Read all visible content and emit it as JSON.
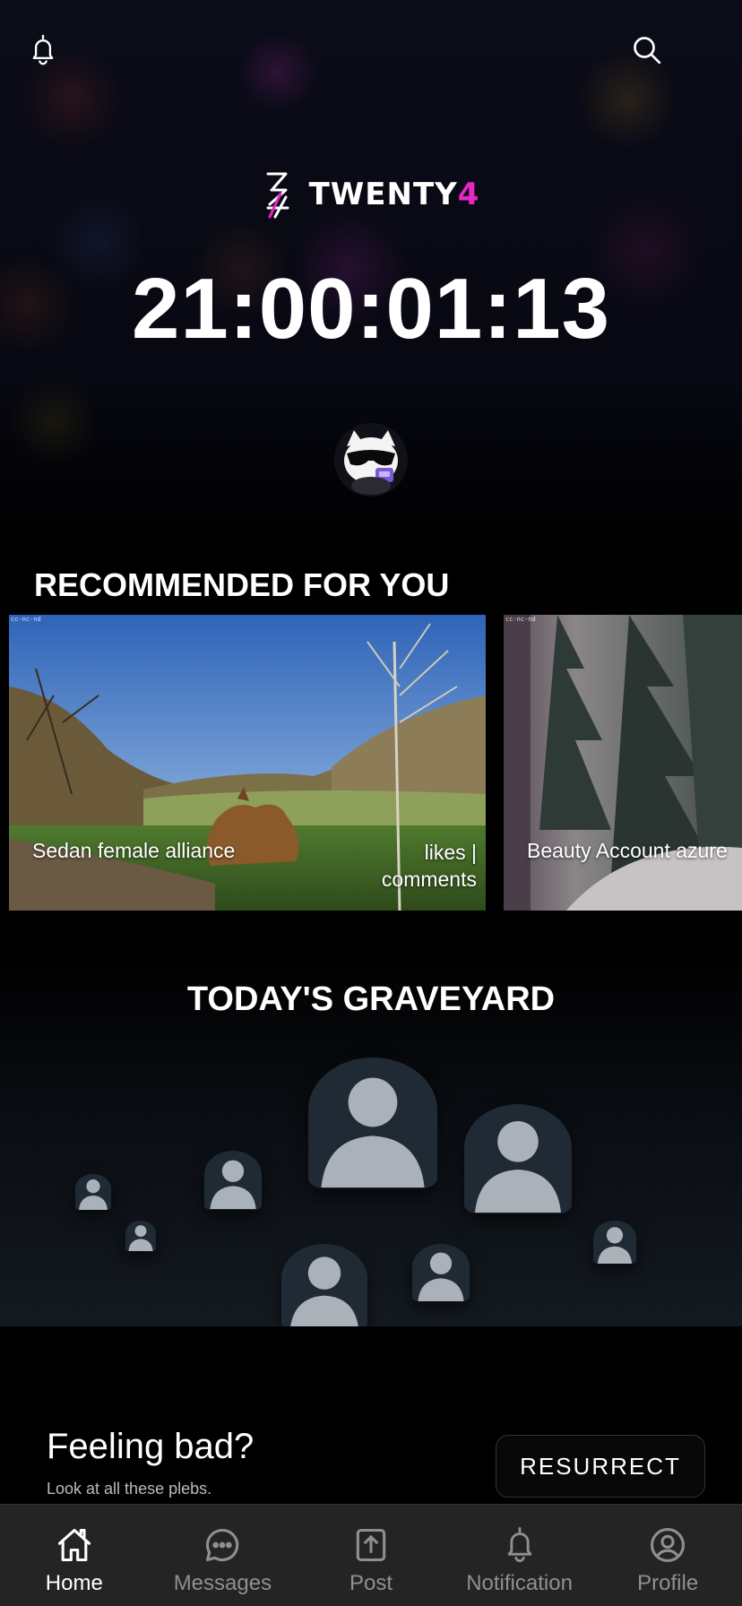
{
  "header": {
    "brand_prefix": "TWENTY",
    "brand_suffix": "4",
    "brand_accent_color": "#e627c7",
    "left_icon": "bell-icon",
    "right_icon": "search-icon"
  },
  "countdown": {
    "value": "21:00:01:13"
  },
  "recommended": {
    "title": "RECOMMENDED FOR YOU",
    "cards": [
      {
        "license": "cc-nc-nd",
        "caption": "Sedan female alliance",
        "meta_line1": "likes |",
        "meta_line2": "comments"
      },
      {
        "license": "cc-nc-nd",
        "caption": "Beauty Account azure"
      }
    ]
  },
  "graveyard": {
    "title": "TODAY'S GRAVEYARD",
    "icon": "person-icon"
  },
  "cta": {
    "title": "Feeling bad?",
    "subtitle": "Look at all these plebs.",
    "button_label": "RESURRECT"
  },
  "tabs": [
    {
      "label": "Home",
      "icon": "home-icon",
      "active": true
    },
    {
      "label": "Messages",
      "icon": "messages-icon",
      "active": false
    },
    {
      "label": "Post",
      "icon": "upload-icon",
      "active": false
    },
    {
      "label": "Notification",
      "icon": "bell-icon",
      "active": false
    },
    {
      "label": "Profile",
      "icon": "profile-icon",
      "active": false
    }
  ]
}
